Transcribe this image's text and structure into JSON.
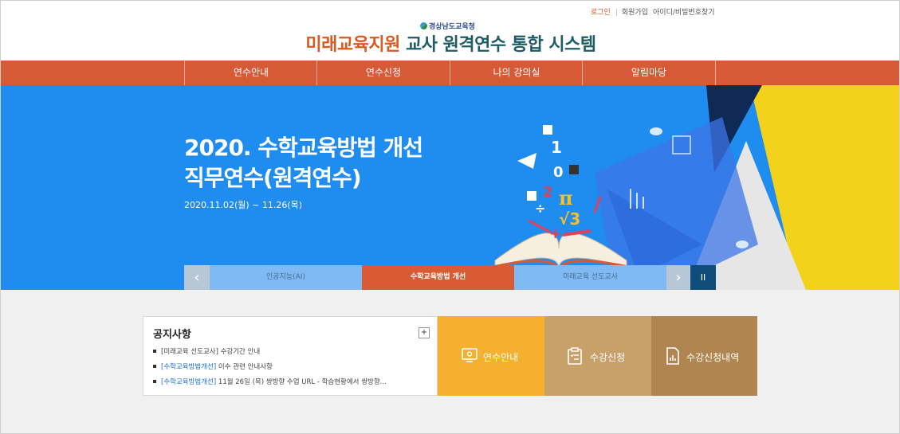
{
  "util": {
    "login": "로그인",
    "join": "회원가입",
    "find": "아이디/비밀번호찾기"
  },
  "brand": {
    "org": "경상남도교육청",
    "title_accent": "미래교육지원",
    "title_main": "교사 원격연수 통합 시스템"
  },
  "nav": {
    "items": [
      "연수안내",
      "연수신청",
      "나의 강의실",
      "알림마당"
    ]
  },
  "hero": {
    "title_line1": "2020. 수학교육방법 개선",
    "title_line2": "직무연수(원격연수)",
    "date": "2020.11.02(월) ~ 11.26(목)",
    "math_glyphs": [
      "1",
      "0",
      "2",
      "π",
      "√3",
      "÷",
      "+"
    ]
  },
  "slider": {
    "prev_icon": "chevron-left-icon",
    "next_icon": "chevron-right-icon",
    "pause_icon": "pause-icon",
    "tabs": [
      "인공지능(AI)",
      "수학교육방법 개선",
      "미래교육 선도교사"
    ],
    "active_index": 1
  },
  "notice": {
    "title": "공지사항",
    "more": "+",
    "items": [
      {
        "tag": "",
        "text": "[미래교육 선도교사] 수강기간 안내"
      },
      {
        "tag": "[수학교육방법개선]",
        "text": " 이수 관련 안내사항"
      },
      {
        "tag": "[수학교육방법개선]",
        "text": " 11월 26일 (목) 쌍방향 수업 URL - 학습현황에서 쌍방향..."
      }
    ]
  },
  "quick": [
    {
      "label": "연수안내",
      "icon": "monitor-icon",
      "color": "#f5b030"
    },
    {
      "label": "수강신청",
      "icon": "clipboard-icon",
      "color": "#c8a06a"
    },
    {
      "label": "수강신청내역",
      "icon": "document-chart-icon",
      "color": "#b08550"
    }
  ],
  "colors": {
    "nav": "#d75a36",
    "hero": "#1f8cf0",
    "accent": "#d9591f",
    "title": "#1d5c66"
  }
}
